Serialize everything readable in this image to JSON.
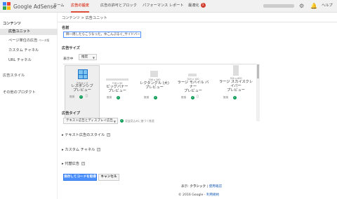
{
  "header": {
    "logo_text": "Google AdSense",
    "brand_colors": [
      "#4285f4",
      "#ea4335",
      "#fbbc05",
      "#34a853"
    ],
    "nav": [
      {
        "label": "ホーム",
        "active": false
      },
      {
        "label": "広告の設定",
        "active": true
      },
      {
        "label": "広告の許可とブロック",
        "active": false
      },
      {
        "label": "パフォーマンス レポート",
        "active": false
      },
      {
        "label": "最適化",
        "active": false
      }
    ],
    "optimize_badge": "1",
    "help_label": "ヘルプ",
    "icons": [
      "gear-icon",
      "bell-icon"
    ]
  },
  "sidebar": {
    "section_title": "コンテンツ",
    "items": [
      {
        "label": "広告ユニット",
        "active": true
      },
      {
        "label": "ページ単位の広告",
        "tag": "ベータ版"
      },
      {
        "label": "カスタム チャネル"
      },
      {
        "label": "URL チャネル"
      }
    ],
    "style_title": "広告スタイル",
    "other_title": "その他のプロダクト"
  },
  "main": {
    "breadcrumb": "コンテンツ > 広告ユニット",
    "name_label": "名前",
    "name_value": "師一周したらこうなった。ゆこんぷるぐ_サイドバー",
    "size_label": "広告サイズ",
    "filter_label": "表示中",
    "filter_value": "推奨",
    "sizes": [
      {
        "dim": "広告サイズ",
        "name": "レスポンシブ",
        "sub": "プレビュー",
        "rec": "推奨"
      },
      {
        "dim": "728 x 90",
        "name": "ビッグバナー",
        "sub": "プレビュー",
        "rec": "推奨"
      },
      {
        "dim": "336 x 280",
        "name": "レクタングル (大)",
        "sub": "プレビュー",
        "rec": "推奨"
      },
      {
        "dim": "320 x 100",
        "name": "ラージ モバイル バナー",
        "sub": "プレビュー",
        "rec": "推奨"
      },
      {
        "dim": "300 x 600",
        "name": "ラージ スカイスクレイパー",
        "sub": "プレビュー",
        "rec": "推奨"
      }
    ],
    "type_label": "広告タイプ",
    "type_value": "テキスト広告とディスプレイ広告",
    "type_note": "収益見込みに基づく推奨",
    "expanders": [
      {
        "label": "テキスト広告のスタイル"
      },
      {
        "label": "カスタム チャネル"
      },
      {
        "label": "代替広告"
      }
    ],
    "save_button": "保存してコードを取得",
    "cancel_button": "キャンセル",
    "footer_view_prefix": "表示:",
    "footer_view_mode": "クラシック",
    "footer_view_sep": " | ",
    "footer_view_link": "使用確認",
    "footer_copyright": "© 2016 Google",
    "footer_sep": " - ",
    "footer_terms": "利用規約"
  }
}
